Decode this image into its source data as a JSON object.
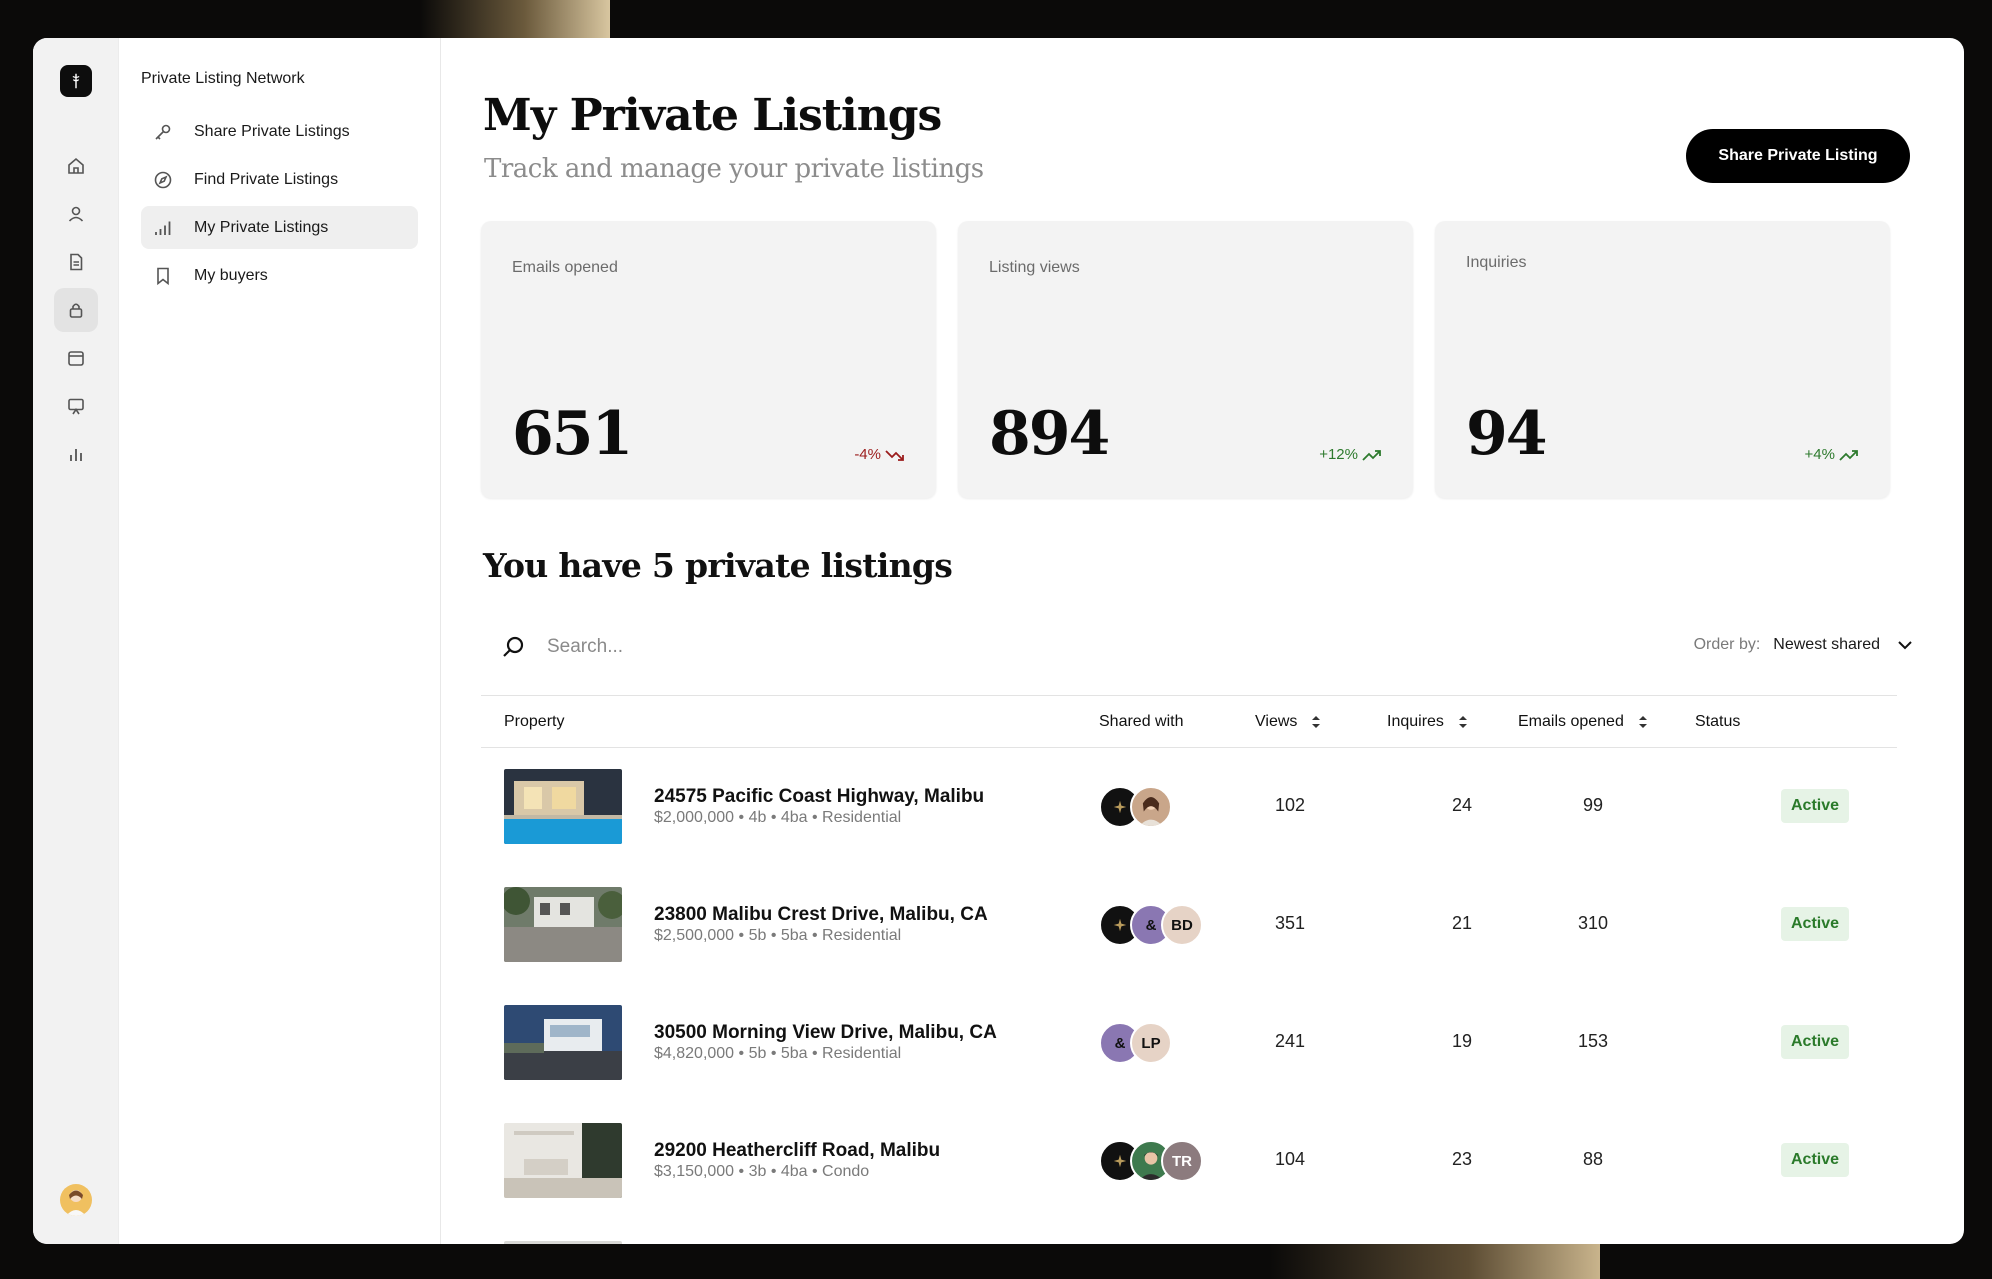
{
  "nav": {
    "network_title": "Private Listing Network",
    "items": [
      {
        "label": "Share Private Listings",
        "icon": "key-icon"
      },
      {
        "label": "Find Private Listings",
        "icon": "compass-icon"
      },
      {
        "label": "My Private Listings",
        "icon": "bar-signal-icon"
      },
      {
        "label": "My buyers",
        "icon": "bookmark-icon"
      }
    ]
  },
  "header": {
    "title": "My Private Listings",
    "subtitle": "Track and manage your private listings",
    "share_button": "Share Private Listing"
  },
  "stats": [
    {
      "label": "Emails opened",
      "value": "651",
      "delta": "-4%",
      "trend": "down"
    },
    {
      "label": "Listing views",
      "value": "894",
      "delta": "+12%",
      "trend": "up"
    },
    {
      "label": "Inquiries",
      "value": "94",
      "delta": "+4%",
      "trend": "up"
    }
  ],
  "listings_heading": "You have 5 private listings",
  "search": {
    "placeholder": "Search..."
  },
  "order": {
    "label": "Order by:",
    "value": "Newest shared"
  },
  "table": {
    "columns": {
      "property": "Property",
      "shared_with": "Shared with",
      "views": "Views",
      "inquires": "Inquires",
      "emails_opened": "Emails opened",
      "status": "Status"
    },
    "rows": [
      {
        "address": "24575 Pacific Coast Highway, Malibu",
        "meta": "$2,000,000 • 4b • 4ba  • Residential",
        "shared": [
          {
            "type": "dark",
            "text": ""
          },
          {
            "type": "photo-f",
            "text": ""
          }
        ],
        "views": "102",
        "inquires": "24",
        "emails": "99",
        "status": "Active"
      },
      {
        "address": "23800 Malibu Crest Drive, Malibu, CA",
        "meta": "$2,500,000 • 5b • 5ba  • Residential",
        "shared": [
          {
            "type": "dark",
            "text": ""
          },
          {
            "type": "amp",
            "text": "&"
          },
          {
            "type": "init",
            "text": "BD"
          }
        ],
        "views": "351",
        "inquires": "21",
        "emails": "310",
        "status": "Active"
      },
      {
        "address": "30500 Morning View Drive, Malibu, CA",
        "meta": "$4,820,000 • 5b • 5ba  • Residential",
        "shared": [
          {
            "type": "amp",
            "text": "&"
          },
          {
            "type": "init",
            "text": "LP"
          }
        ],
        "views": "241",
        "inquires": "19",
        "emails": "153",
        "status": "Active"
      },
      {
        "address": "29200 Heathercliff Road, Malibu",
        "meta": "$3,150,000 • 3b • 4ba  • Condo",
        "shared": [
          {
            "type": "dark",
            "text": ""
          },
          {
            "type": "photo-g",
            "text": ""
          },
          {
            "type": "init-tr",
            "text": "TR"
          }
        ],
        "views": "104",
        "inquires": "23",
        "emails": "88",
        "status": "Active"
      }
    ]
  },
  "colors": {
    "accent": "#000000",
    "down": "#9b1c1c",
    "up": "#2d7a2d",
    "status_bg": "#e6f3e6"
  }
}
